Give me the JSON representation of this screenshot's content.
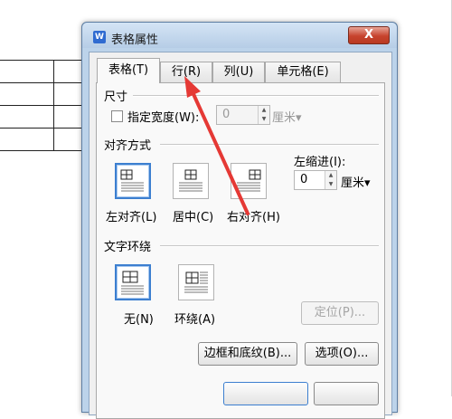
{
  "dialog": {
    "app_icon": "W",
    "title": "表格属性",
    "close_label": "X"
  },
  "tabs": [
    {
      "label": "表格(T)",
      "active": true
    },
    {
      "label": "行(R)",
      "active": false
    },
    {
      "label": "列(U)",
      "active": false
    },
    {
      "label": "单元格(E)",
      "active": false
    }
  ],
  "size": {
    "section_title": "尺寸",
    "specify_width_label": "指定宽度(W):",
    "width_value": "0",
    "unit": "厘米▾"
  },
  "alignment": {
    "section_title": "对齐方式",
    "options": [
      {
        "label": "左对齐(L)",
        "selected": true
      },
      {
        "label": "居中(C)",
        "selected": false
      },
      {
        "label": "右对齐(H)",
        "selected": false
      }
    ],
    "indent_label": "左缩进(I):",
    "indent_value": "0",
    "indent_unit": "厘米▾"
  },
  "wrapping": {
    "section_title": "文字环绕",
    "options": [
      {
        "label": "无(N)",
        "selected": true
      },
      {
        "label": "环绕(A)",
        "selected": false
      }
    ],
    "position_button": "定位(P)..."
  },
  "buttons": {
    "borders_shading": "边框和底纹(B)...",
    "options": "选项(O)..."
  },
  "colors": {
    "accent": "#3c7fd0",
    "annotation_arrow": "#e53935"
  }
}
